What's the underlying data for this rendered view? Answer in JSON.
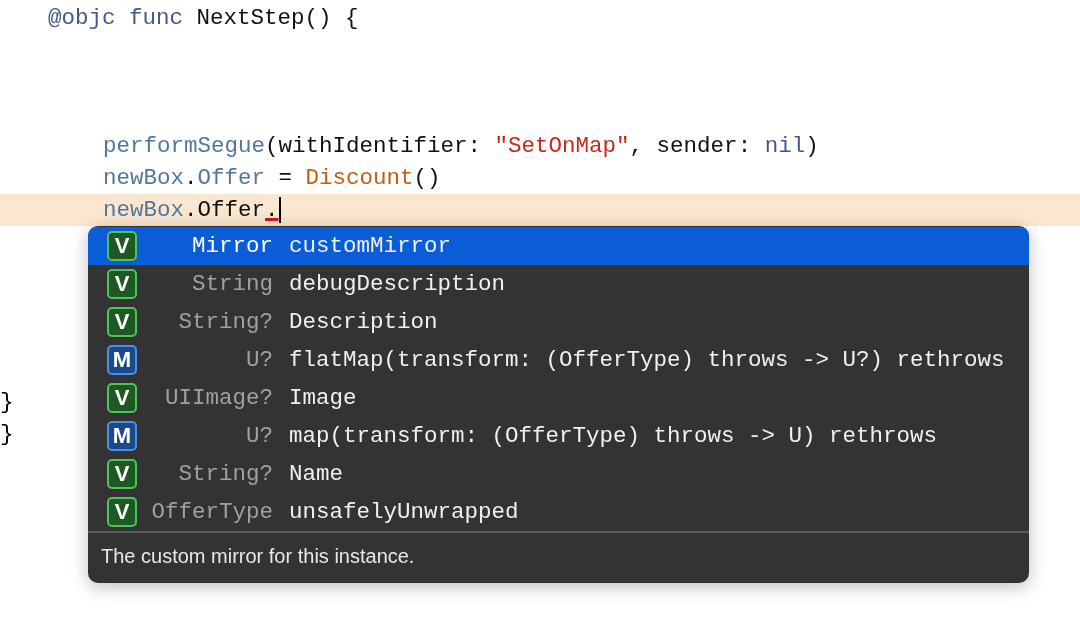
{
  "editor": {
    "declaration": {
      "tokens": [
        {
          "kind": "keyword",
          "text": "@objc"
        },
        {
          "kind": "keyword",
          "text": " func"
        },
        {
          "kind": "plain",
          "text": " NextStep() {"
        }
      ]
    },
    "statements": [
      {
        "current": false,
        "tokens": [
          {
            "kind": "member",
            "text": "performSegue"
          },
          {
            "kind": "plain",
            "text": "(withIdentifier: "
          },
          {
            "kind": "string",
            "text": "\"SetOnMap\""
          },
          {
            "kind": "plain",
            "text": ", sender: "
          },
          {
            "kind": "keyword",
            "text": "nil"
          },
          {
            "kind": "plain",
            "text": ")"
          }
        ]
      },
      {
        "current": false,
        "tokens": [
          {
            "kind": "member",
            "text": "newBox"
          },
          {
            "kind": "plain",
            "text": "."
          },
          {
            "kind": "member",
            "text": "Offer"
          },
          {
            "kind": "plain",
            "text": " = "
          },
          {
            "kind": "type",
            "text": "Discount"
          },
          {
            "kind": "plain",
            "text": "()"
          }
        ]
      },
      {
        "current": true,
        "tokens": [
          {
            "kind": "member",
            "text": "newBox"
          },
          {
            "kind": "plain",
            "text": ".Offer"
          },
          {
            "kind": "error",
            "text": "."
          }
        ]
      }
    ],
    "closing": [
      "}",
      "}"
    ]
  },
  "completion": {
    "items": [
      {
        "kind": "variable",
        "badge": "V",
        "type": "Mirror",
        "name": "customMirror",
        "selected": true
      },
      {
        "kind": "variable",
        "badge": "V",
        "type": "String",
        "name": "debugDescription",
        "selected": false
      },
      {
        "kind": "variable",
        "badge": "V",
        "type": "String?",
        "name": "Description",
        "selected": false
      },
      {
        "kind": "method",
        "badge": "M",
        "type": "U?",
        "name": "flatMap(transform: (OfferType) throws -> U?) rethrows",
        "selected": false
      },
      {
        "kind": "variable",
        "badge": "V",
        "type": "UIImage?",
        "name": "Image",
        "selected": false
      },
      {
        "kind": "method",
        "badge": "M",
        "type": "U?",
        "name": "map(transform: (OfferType) throws -> U) rethrows",
        "selected": false
      },
      {
        "kind": "variable",
        "badge": "V",
        "type": "String?",
        "name": "Name",
        "selected": false
      },
      {
        "kind": "variable",
        "badge": "V",
        "type": "OfferType",
        "name": "unsafelyUnwrapped",
        "selected": false
      }
    ],
    "description": "The custom mirror for this instance."
  }
}
